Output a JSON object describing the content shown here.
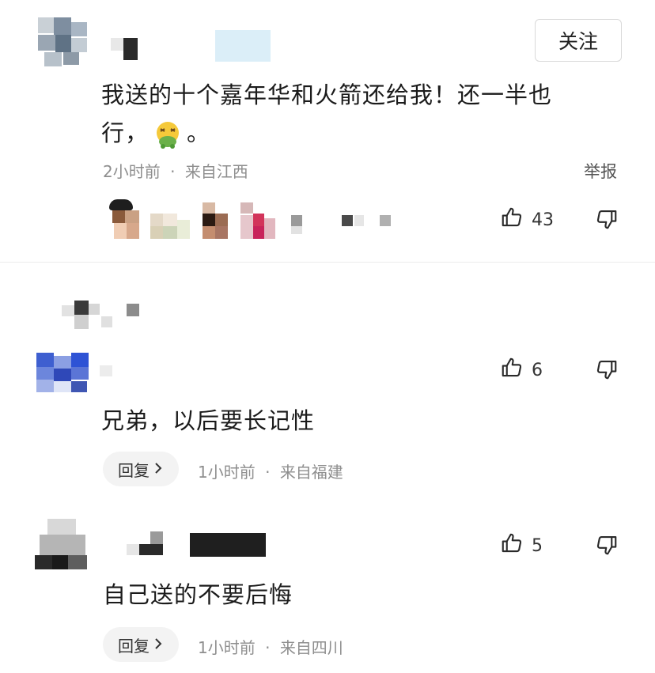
{
  "follow_button": {
    "label": "关注"
  },
  "comments": [
    {
      "text_line1": "我送的十个嘉年华和火箭还给我！还一半也",
      "text_line2_pre": "行，",
      "text_line2_post": "。",
      "emoji": "nauseated-face-icon",
      "time": "2小时前",
      "location": "来自江西",
      "report_label": "举报",
      "likes": "43"
    },
    {
      "text": "兄弟，以后要长记性",
      "likes": "6",
      "reply_label": "回复",
      "time": "1小时前",
      "location": "来自福建"
    },
    {
      "text": "自己送的不要后悔",
      "likes": "5",
      "reply_label": "回复",
      "time": "1小时前",
      "location": "来自四川"
    }
  ],
  "separator": "·",
  "colors": {
    "text": "#1b1b1b",
    "meta": "#8e8e8e",
    "reply_bg": "#f3f3f3"
  }
}
